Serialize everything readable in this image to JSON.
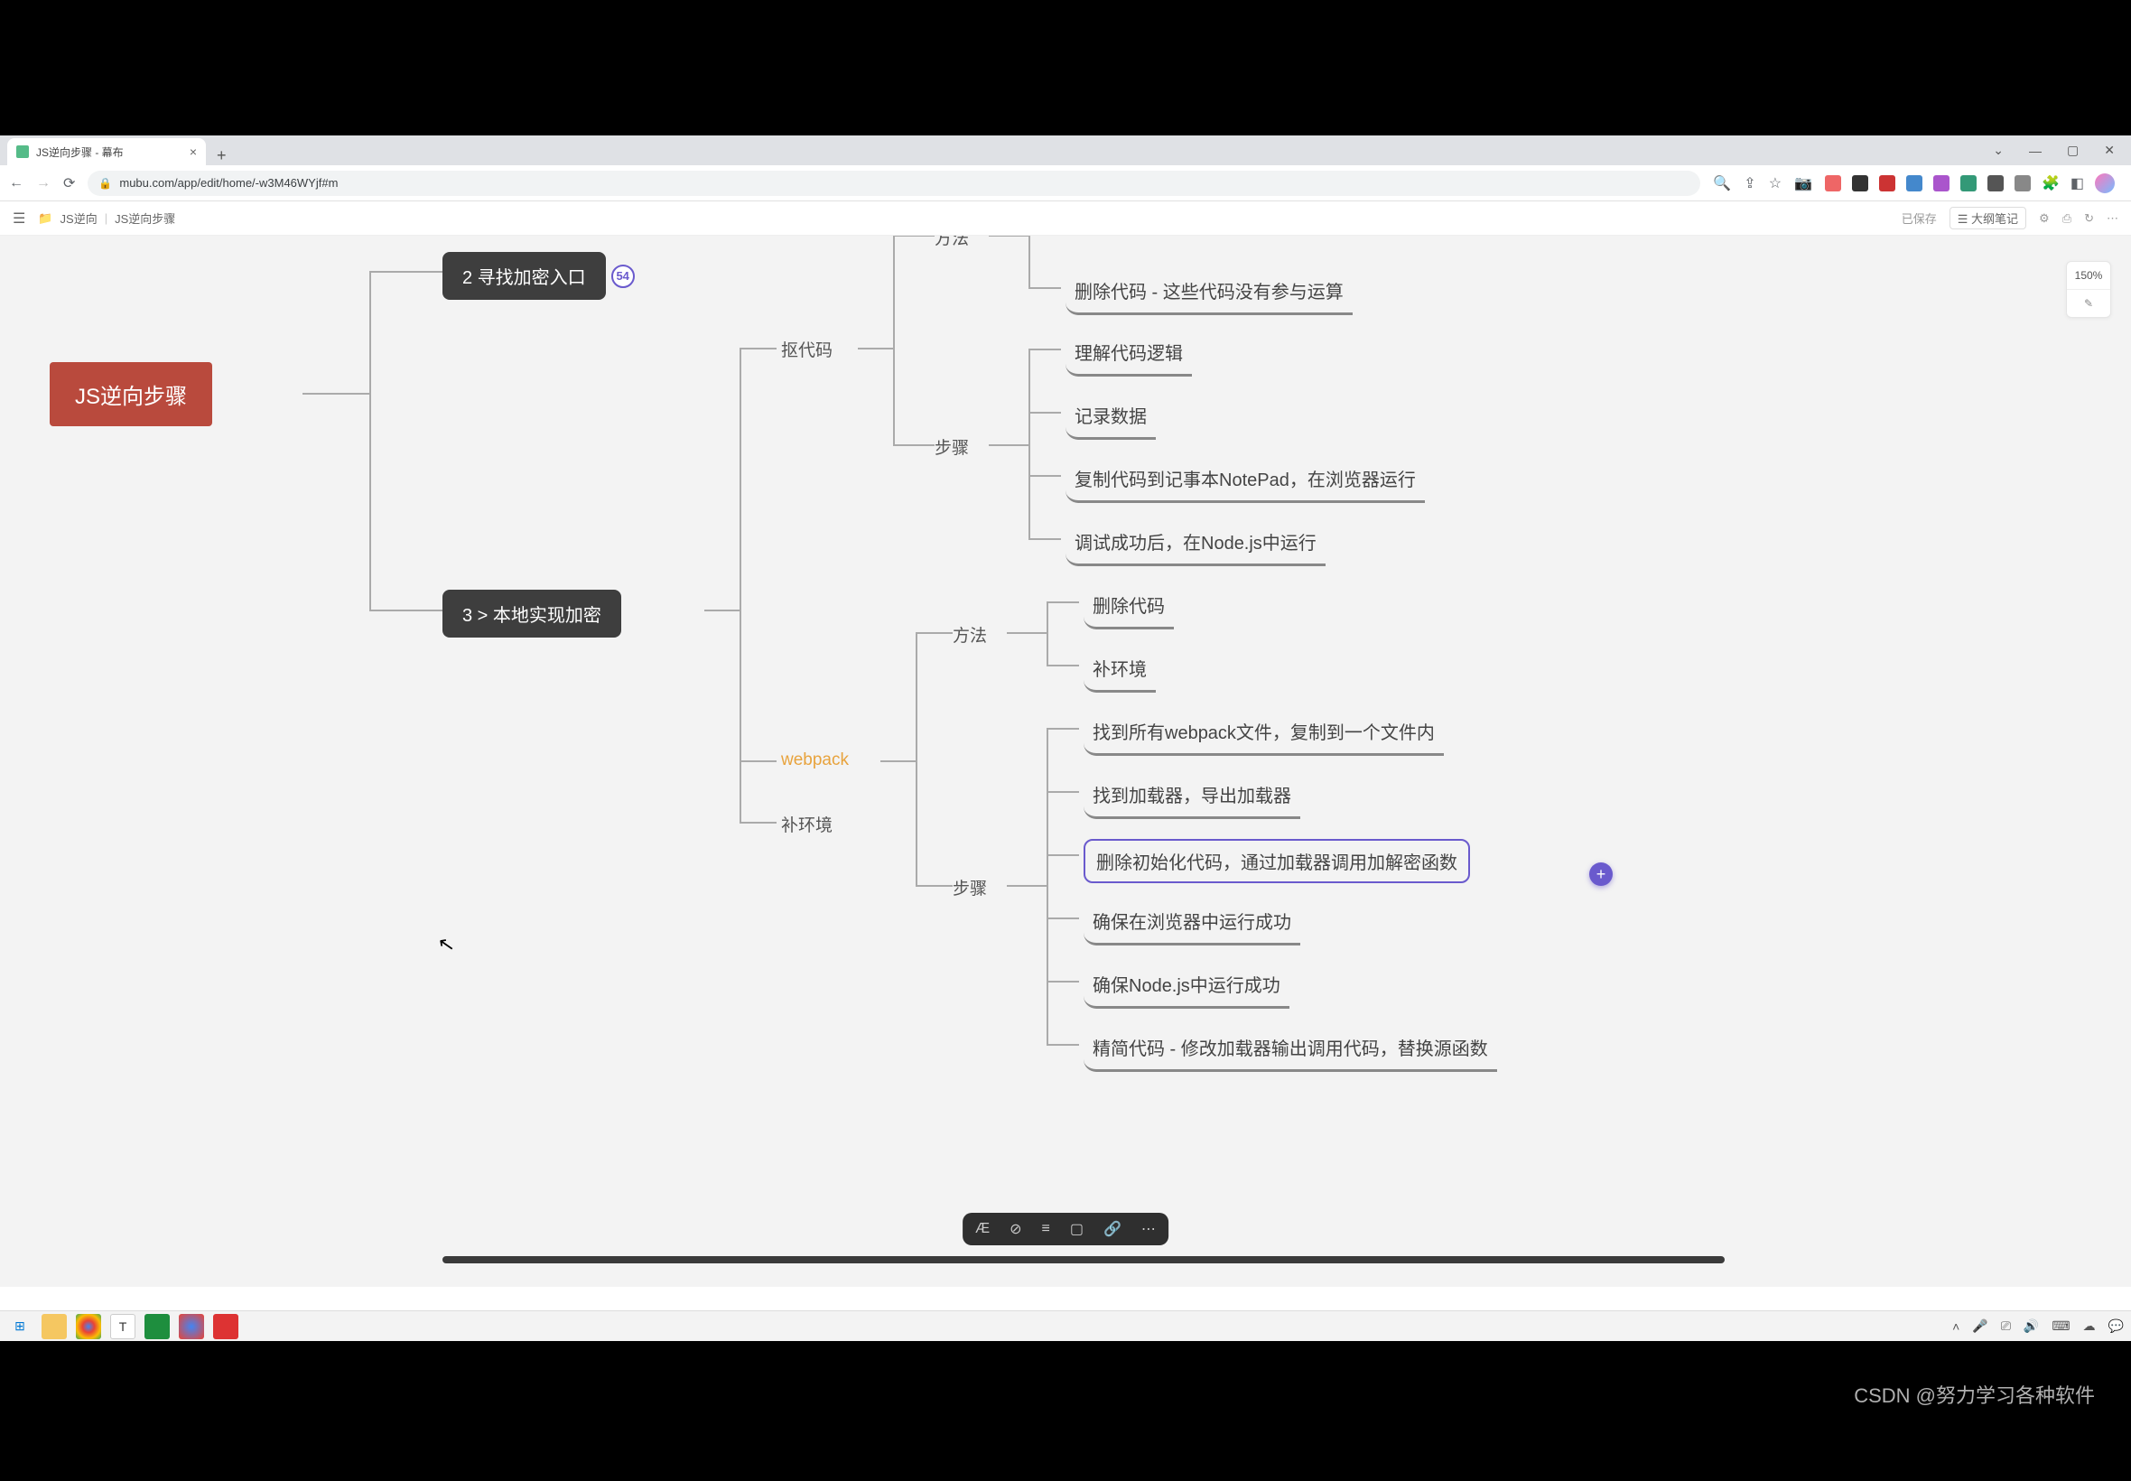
{
  "browser": {
    "tab_title": "JS逆向步骤 - 幕布",
    "new_tab": "+",
    "close_tab": "×",
    "url": "mubu.com/app/edit/home/-w3M46WYjf#m",
    "win_min": "—",
    "win_chevron": "⌄",
    "win_max": "▢",
    "win_close": "✕"
  },
  "appbar": {
    "breadcrumb_folder_icon": "📁",
    "breadcrumb_folder": "JS逆向",
    "breadcrumb_doc": "JS逆向步骤",
    "saved": "已保存",
    "outline_btn": "☰ 大纲笔记",
    "icons": [
      "⚙",
      "⎙",
      "↻",
      "⋯"
    ]
  },
  "zoom": {
    "value": "150%",
    "icon": "✎"
  },
  "mind": {
    "root": "JS逆向步骤",
    "n2": "2 寻找加密入口",
    "n2_badge": "54",
    "n3": "3 > 本地实现加密",
    "koudaima": "抠代码",
    "fangfa_top": "方法",
    "buzhou1": "步骤",
    "webpack": "webpack",
    "buhuanjing_label": "补环境",
    "fangfa2": "方法",
    "buzhou2": "步骤",
    "leaf1": "删除代码 - 这些代码没有参与运算",
    "leaf2": "理解代码逻辑",
    "leaf3": "记录数据",
    "leaf4": "复制代码到记事本NotePad，在浏览器运行",
    "leaf5": "调试成功后，在Node.js中运行",
    "leaf6": "删除代码",
    "leaf7": "补环境",
    "leaf8": "找到所有webpack文件，复制到一个文件内",
    "leaf9": "找到加载器，导出加载器",
    "leaf10": "删除初始化代码，通过加载器调用加解密函数",
    "leaf11": "确保在浏览器中运行成功",
    "leaf12": "确保Node.js中运行成功",
    "leaf13": "精简代码 - 修改加载器输出调用代码，替换源函数",
    "add": "+"
  },
  "floatbar": {
    "items": [
      "Æ",
      "⊘",
      "≡",
      "▢",
      "🔗",
      "⋯"
    ]
  },
  "taskbar": {
    "start": "⊞"
  },
  "tray": {
    "items": [
      "˄",
      "🎤",
      "⎚",
      "🔊",
      "⌨",
      "☁",
      "💬"
    ]
  },
  "watermark": "CSDN @努力学习各种软件",
  "ext_colors": [
    "#888",
    "#e66",
    "#333",
    "#c33",
    "#48c",
    "#a5c",
    "#397",
    "#555",
    "#888",
    "#555",
    "#555"
  ]
}
